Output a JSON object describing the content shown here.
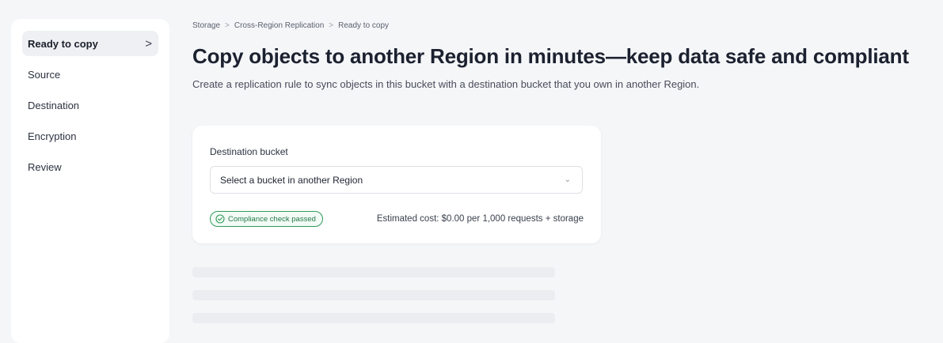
{
  "sidebar": {
    "items": [
      {
        "label": "Ready to copy"
      },
      {
        "label": "Source"
      },
      {
        "label": "Destination"
      },
      {
        "label": "Encryption"
      },
      {
        "label": "Review"
      }
    ],
    "active_chevron": ">"
  },
  "breadcrumb": {
    "items": [
      "Storage",
      "Cross-Region Replication",
      "Ready to copy"
    ],
    "separator": ">"
  },
  "page": {
    "title": "Copy objects to another Region in minutes—keep data safe and compliant",
    "subtitle": "Create a replication rule to sync objects in this bucket with a destination bucket that you own in another Region."
  },
  "card": {
    "field_label": "Destination bucket",
    "select_value": "Select a bucket in another Region",
    "badge_label": "Compliance check passed",
    "cost_text": "Estimated cost: $0.00 per 1,000 requests + storage"
  },
  "colors": {
    "accent_green": "#2e9c5a",
    "active_bg": "#eef0f3"
  }
}
